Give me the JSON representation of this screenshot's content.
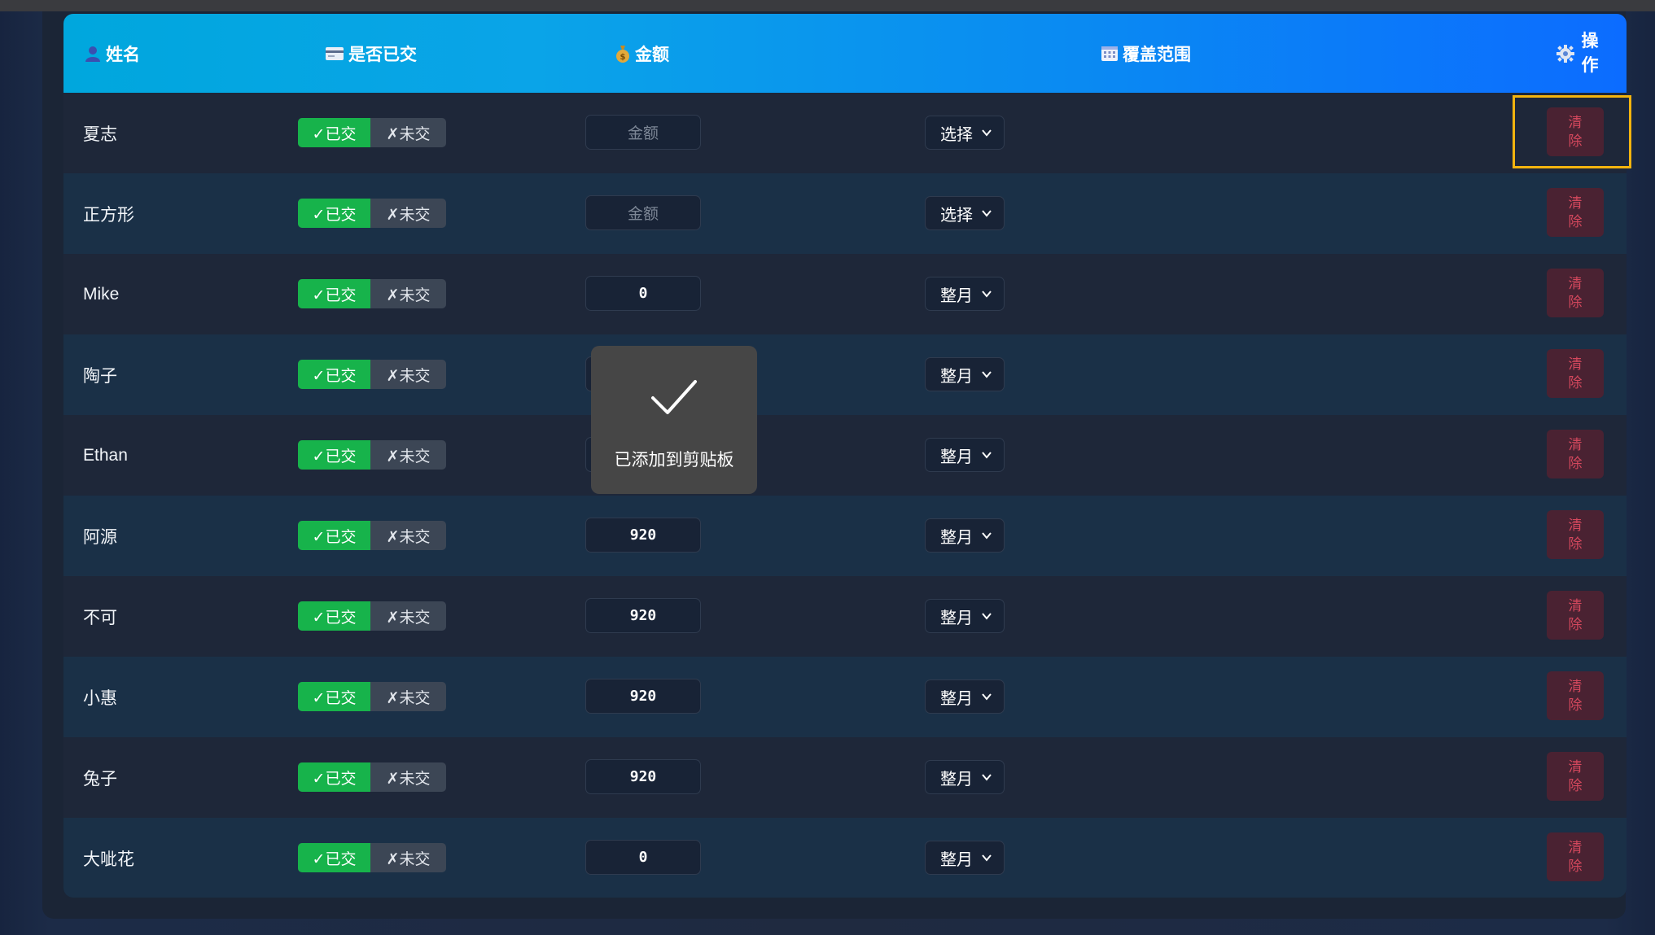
{
  "colors": {
    "header_start": "#00a7dd",
    "header_end": "#0c6cff",
    "paid_green": "#17b34b",
    "clear_red": "#d4485d",
    "focus_yellow": "#f3b40f"
  },
  "header": {
    "name": {
      "icon": "person-icon",
      "label": "姓名"
    },
    "paid": {
      "icon": "card-icon",
      "label": "是否已交"
    },
    "amount": {
      "icon": "money-bag-icon",
      "label": "金额"
    },
    "range": {
      "icon": "calendar-icon",
      "label": "覆盖范围"
    },
    "op": {
      "icon": "gear-icon",
      "label": "操作"
    }
  },
  "toggle": {
    "paid_label": "✓已交",
    "unpaid_label": "✗未交"
  },
  "amount_placeholder": "金额",
  "clear_label": "清除",
  "rows": [
    {
      "name": "夏志",
      "amount": "",
      "range": "选择",
      "focused": true
    },
    {
      "name": "正方形",
      "amount": "",
      "range": "选择"
    },
    {
      "name": "Mike",
      "amount": "0",
      "range": "整月"
    },
    {
      "name": "陶子",
      "amount": "",
      "range": "整月"
    },
    {
      "name": "Ethan",
      "amount": "",
      "range": "整月"
    },
    {
      "name": "阿源",
      "amount": "920",
      "range": "整月"
    },
    {
      "name": "不可",
      "amount": "920",
      "range": "整月"
    },
    {
      "name": "小惠",
      "amount": "920",
      "range": "整月"
    },
    {
      "name": "兔子",
      "amount": "920",
      "range": "整月"
    },
    {
      "name": "大呲花",
      "amount": "0",
      "range": "整月"
    }
  ],
  "toast": {
    "icon": "checkmark-icon",
    "message": "已添加到剪贴板"
  }
}
